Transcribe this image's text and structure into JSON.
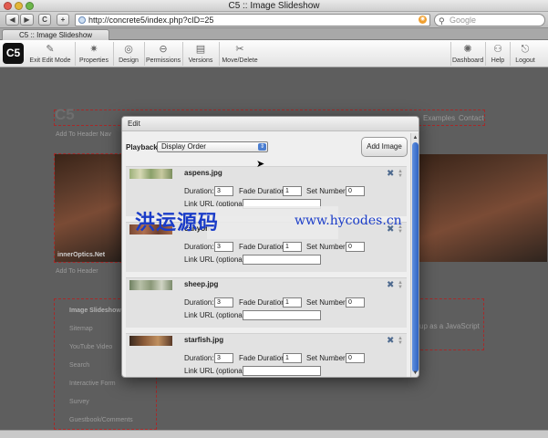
{
  "window": {
    "title": "C5 :: Image Slideshow"
  },
  "browser": {
    "back": "◀",
    "forward": "▶",
    "reload": "C",
    "add": "+",
    "url": "http://concrete5/index.php?cID=25",
    "search_placeholder": "Google",
    "tab_label": "C5 :: Image Slideshow"
  },
  "cms_toolbar": {
    "logo": "C5",
    "left_items": [
      {
        "label": "Exit Edit Mode",
        "icon": "exit-edit-icon"
      },
      {
        "label": "Properties",
        "icon": "properties-icon"
      },
      {
        "label": "Design",
        "icon": "design-icon"
      },
      {
        "label": "Permissions",
        "icon": "permissions-icon"
      },
      {
        "label": "Versions",
        "icon": "versions-icon"
      },
      {
        "label": "Move/Delete",
        "icon": "move-delete-icon"
      }
    ],
    "right_items": [
      {
        "label": "Dashboard",
        "icon": "dashboard-icon"
      },
      {
        "label": "Help",
        "icon": "help-icon"
      },
      {
        "label": "Logout",
        "icon": "logout-icon"
      }
    ]
  },
  "background_page": {
    "site_logo": "C5",
    "add_to_header_nav": "Add To Header Nav",
    "nav_examples": "Examples",
    "nav_contact": "Contact",
    "add_to_header": "Add To Header",
    "photo_caption": "innerOptics.Net",
    "sidebar_items": [
      "Image Slideshow",
      "Sitemap",
      "YouTube Video",
      "Search",
      "Interactive Form",
      "Survey",
      "Guestbook/Comments"
    ],
    "content_snippet": "up as a JavaScript"
  },
  "modal": {
    "title": "Edit",
    "playback_label": "Playback",
    "playback_value": "Display Order",
    "add_image_button": "Add Image",
    "duration_label": "Duration:",
    "fade_label": "Fade Duration:",
    "set_label": "Set Number:",
    "link_label": "Link URL (optional):",
    "images": [
      {
        "filename": "aspens.jpg",
        "duration": "3",
        "fade": "1",
        "set": "0",
        "link": ""
      },
      {
        "filename": "canyon",
        "duration": "3",
        "fade": "1",
        "set": "0",
        "link": ""
      },
      {
        "filename": "sheep.jpg",
        "duration": "3",
        "fade": "1",
        "set": "0",
        "link": ""
      },
      {
        "filename": "starfish.jpg",
        "duration": "3",
        "fade": "1",
        "set": "0",
        "link": ""
      }
    ]
  },
  "watermark": {
    "text_cn": "洪运源码",
    "url": "www.hycodes.cn"
  },
  "colors": {
    "scroll_thumb": "#3a6fd0",
    "watermark": "#1a3cc8",
    "dashed_border": "#a52a2a"
  }
}
